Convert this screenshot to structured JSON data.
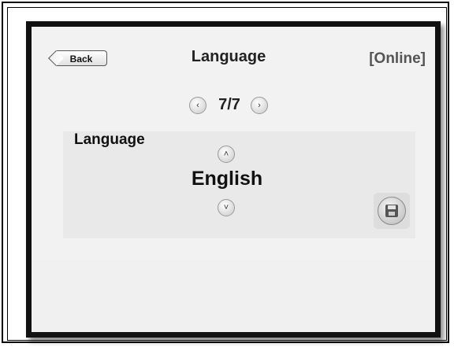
{
  "header": {
    "back_label": "Back",
    "title": "Language",
    "status": "[Online]"
  },
  "pager": {
    "indicator": "7/7",
    "prev_glyph": "‹",
    "next_glyph": "›"
  },
  "setting": {
    "label": "Language",
    "value": "English",
    "up_glyph": "˄",
    "down_glyph": "˅"
  },
  "icons": {
    "prev": "chevron-left-icon",
    "next": "chevron-right-icon",
    "up": "chevron-up-icon",
    "down": "chevron-down-icon",
    "save": "floppy-disk-icon"
  },
  "colors": {
    "screen_background": "#f2f2f2",
    "panel_background": "#e9e9e9",
    "status_text": "#555555",
    "bezel": "#111111"
  }
}
